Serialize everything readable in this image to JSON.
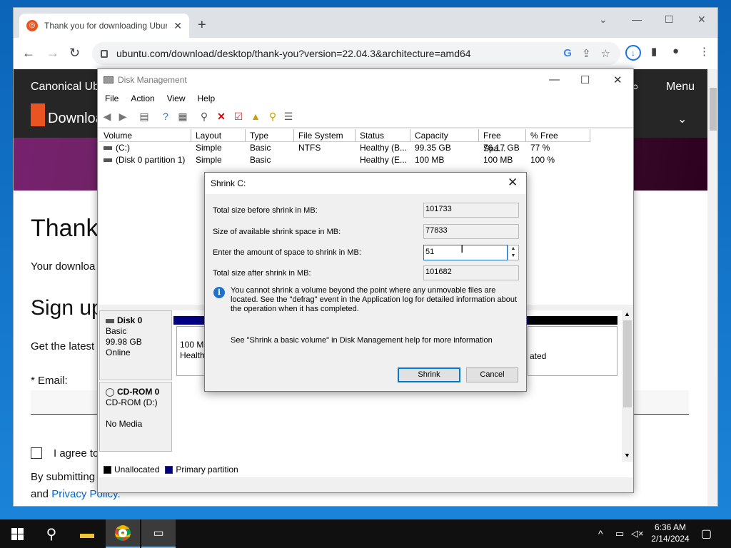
{
  "browser": {
    "tab_title": "Thank you for downloading Ubuntu",
    "new_tab": "+",
    "url": "ubuntu.com/download/desktop/thank-you?version=22.04.3&architecture=amd64"
  },
  "ubuntu_page": {
    "brand": "Canonical Ub",
    "menu": "Menu",
    "download": "Downloa",
    "thank_you": "Thank y",
    "your_download": "Your downloa",
    "sign_up": "Sign up",
    "get_latest": "Get the latest",
    "email_label": "* Email:",
    "agree": "I agree to",
    "by_submitting": "By submitting",
    "and": "and ",
    "privacy_policy": "Privacy Policy."
  },
  "disk_management": {
    "title": "Disk Management",
    "menu": [
      "File",
      "Action",
      "View",
      "Help"
    ],
    "columns": [
      "Volume",
      "Layout",
      "Type",
      "File System",
      "Status",
      "Capacity",
      "Free Spa...",
      "% Free"
    ],
    "rows": [
      {
        "volume": "(C:)",
        "layout": "Simple",
        "type": "Basic",
        "fs": "NTFS",
        "status": "Healthy (B...",
        "capacity": "99.35 GB",
        "free": "76.17 GB",
        "pct": "77 %"
      },
      {
        "volume": "(Disk 0 partition 1)",
        "layout": "Simple",
        "type": "Basic",
        "fs": "",
        "status": "Healthy (E...",
        "capacity": "100 MB",
        "free": "100 MB",
        "pct": "100 %"
      }
    ],
    "disk0": {
      "name": "Disk 0",
      "type": "Basic",
      "size": "99.98 GB",
      "state": "Online"
    },
    "cdrom": {
      "name": "CD-ROM 0",
      "type": "CD-ROM (D:)",
      "media": "No Media"
    },
    "partition_small": {
      "size": "100 MB",
      "status": "Healthy"
    },
    "partition_main_status_fragment": "ated",
    "legend": {
      "unallocated": "Unallocated",
      "primary": "Primary partition"
    }
  },
  "shrink_dialog": {
    "title": "Shrink C:",
    "total_before_label": "Total size before shrink in MB:",
    "total_before": "101733",
    "available_label": "Size of available shrink space in MB:",
    "available": "77833",
    "amount_label": "Enter the amount of space to shrink in MB:",
    "amount": "51",
    "total_after_label": "Total size after shrink in MB:",
    "total_after": "101682",
    "info": "You cannot shrink a volume beyond the point where any unmovable files are located. See the \"defrag\" event in the Application log for detailed information about the operation when it has completed.",
    "help": "See \"Shrink a basic volume\" in Disk Management help for more information",
    "shrink_button": "Shrink",
    "cancel_button": "Cancel"
  },
  "taskbar": {
    "time": "6:36 AM",
    "date": "2/14/2024"
  }
}
